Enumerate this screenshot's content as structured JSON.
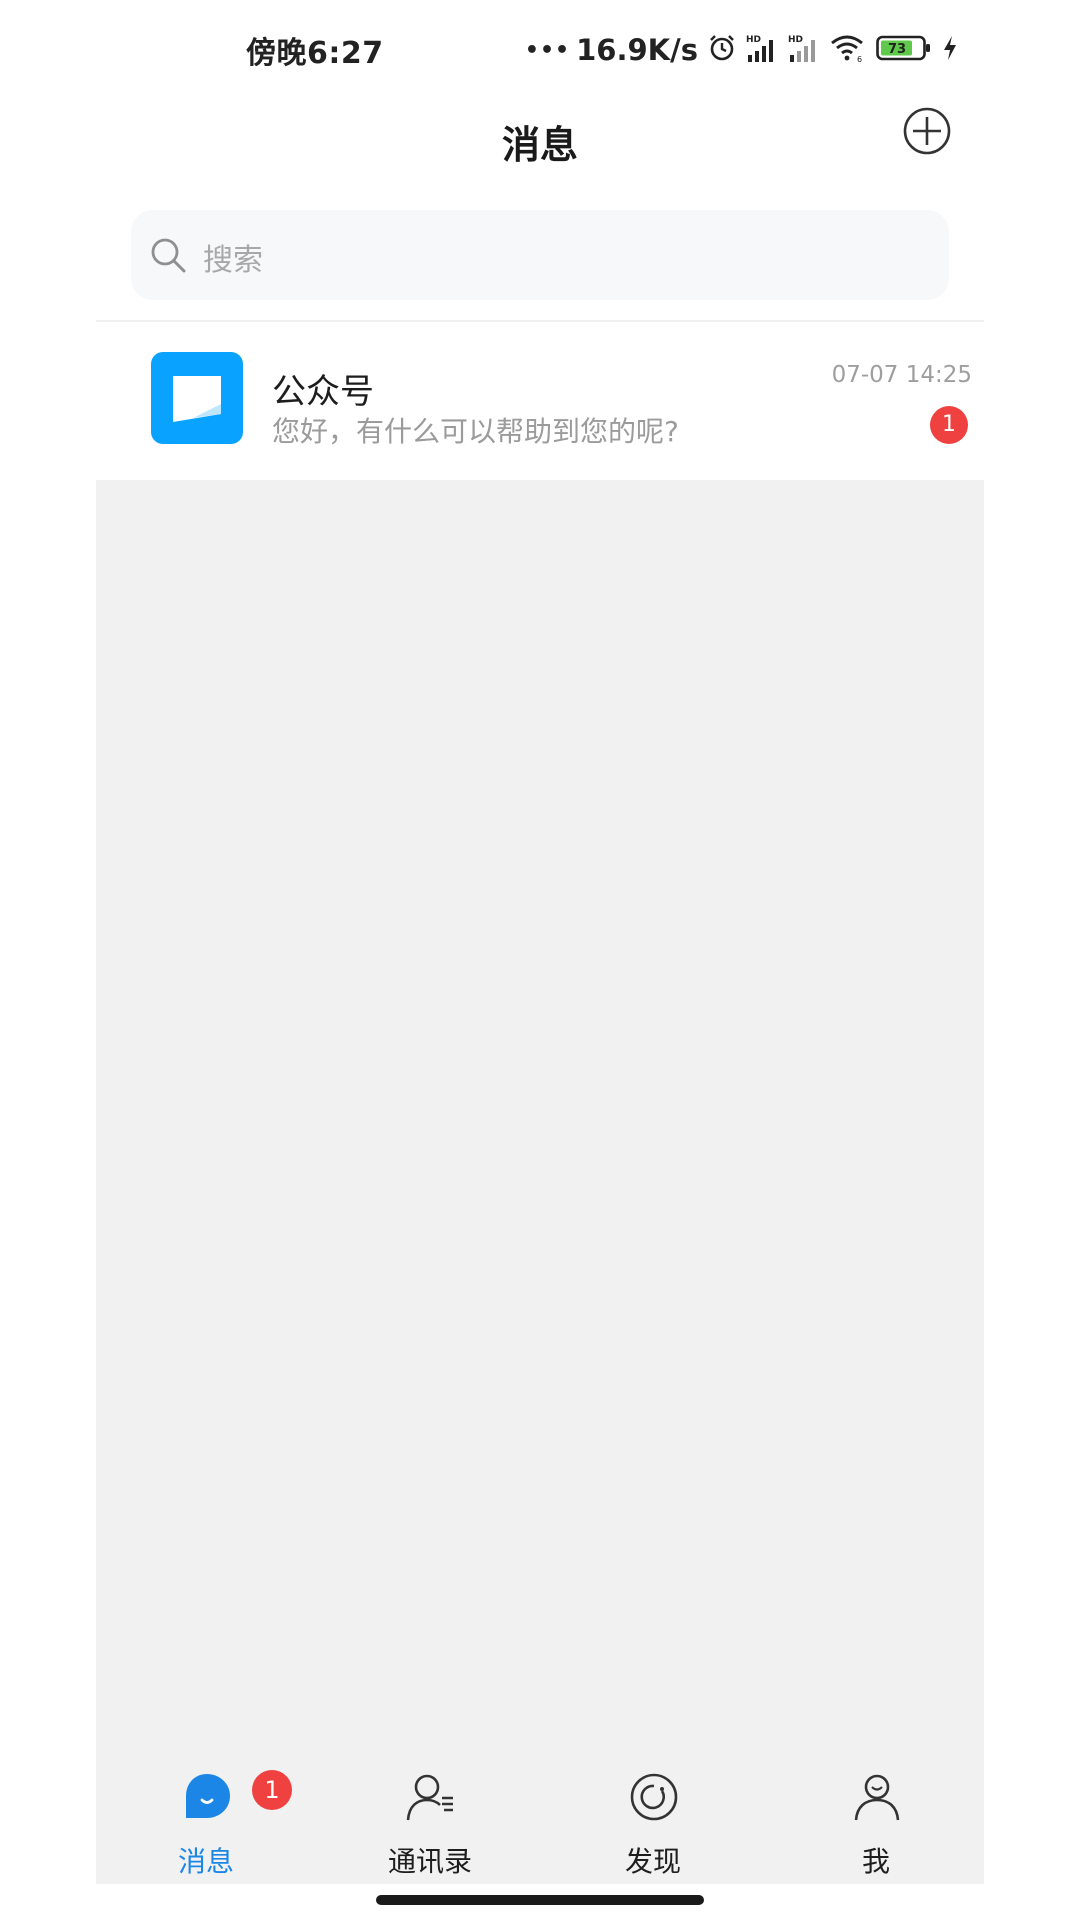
{
  "status_bar": {
    "time": "傍晚6:27",
    "dots": "•••",
    "net_speed": "16.9K/s",
    "battery": "73",
    "icons": [
      "alarm-icon",
      "signal-hd-icon",
      "signal-hd-icon",
      "wifi-icon",
      "battery-icon",
      "charging-icon"
    ]
  },
  "header": {
    "title": "消息",
    "add_icon": "plus-circle-icon"
  },
  "search": {
    "placeholder": "搜索",
    "icon": "search-icon"
  },
  "conversations": [
    {
      "name": "公众号",
      "preview": "您好，有什么可以帮助到您的呢?",
      "time": "07-07 14:25",
      "unread": "1",
      "avatar_icon": "chat-bubble-icon",
      "avatar_color": "#0aa2ff"
    }
  ],
  "tabbar": {
    "tabs": [
      {
        "label": "消息",
        "icon": "message-icon",
        "active": true,
        "badge": "1"
      },
      {
        "label": "通讯录",
        "icon": "contacts-icon",
        "active": false
      },
      {
        "label": "发现",
        "icon": "discover-icon",
        "active": false
      },
      {
        "label": "我",
        "icon": "profile-icon",
        "active": false
      }
    ]
  },
  "colors": {
    "accent": "#1b86e6",
    "badge": "#f04141",
    "background": "#f1f1f2",
    "avatar": "#0aa2ff"
  }
}
